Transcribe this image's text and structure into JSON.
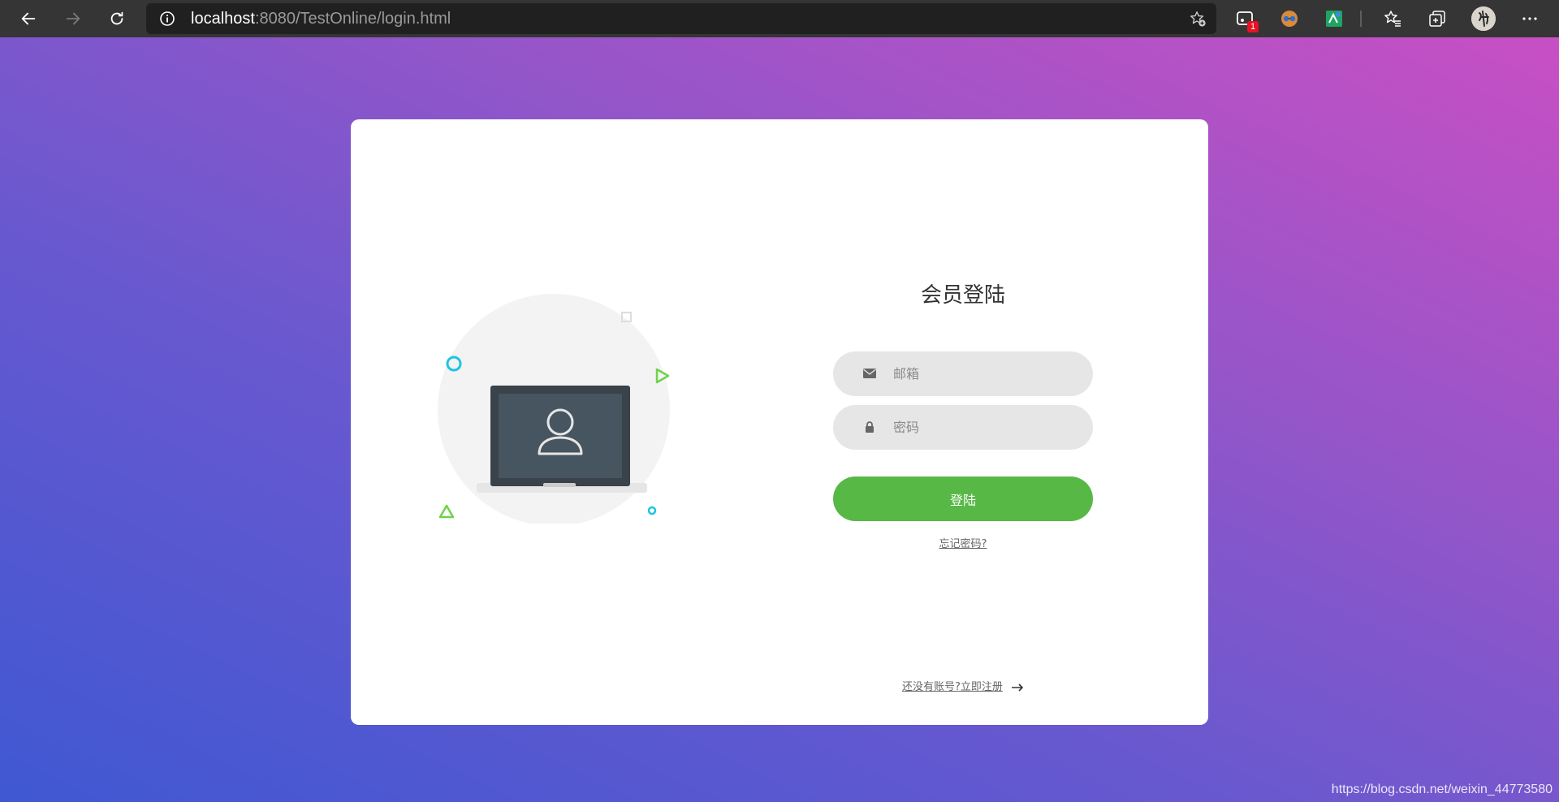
{
  "browser": {
    "url_host": "localhost",
    "url_rest": ":8080/TestOnline/login.html",
    "extension_badge": "1"
  },
  "icons": {
    "back": "arrow-left",
    "forward": "arrow-right",
    "reload": "refresh",
    "info": "info-circle",
    "favorite_add": "star-plus",
    "favorites": "star-list",
    "collections": "collections",
    "more": "ellipsis",
    "email_field": "envelope",
    "password_field": "lock",
    "register_arrow": "long-arrow-right"
  },
  "login": {
    "title": "会员登陆",
    "email_placeholder": "邮箱",
    "password_placeholder": "密码",
    "submit_label": "登陆",
    "forgot_label": "忘记密码?",
    "register_label": "还没有账号?立即注册"
  },
  "colors": {
    "accent_button": "#57b846",
    "card_bg": "#ffffff",
    "field_bg": "#e6e6e6",
    "bg_gradient_start": "#c84fc4",
    "bg_gradient_end": "#3f58d2"
  },
  "watermark": "https://blog.csdn.net/weixin_44773580"
}
